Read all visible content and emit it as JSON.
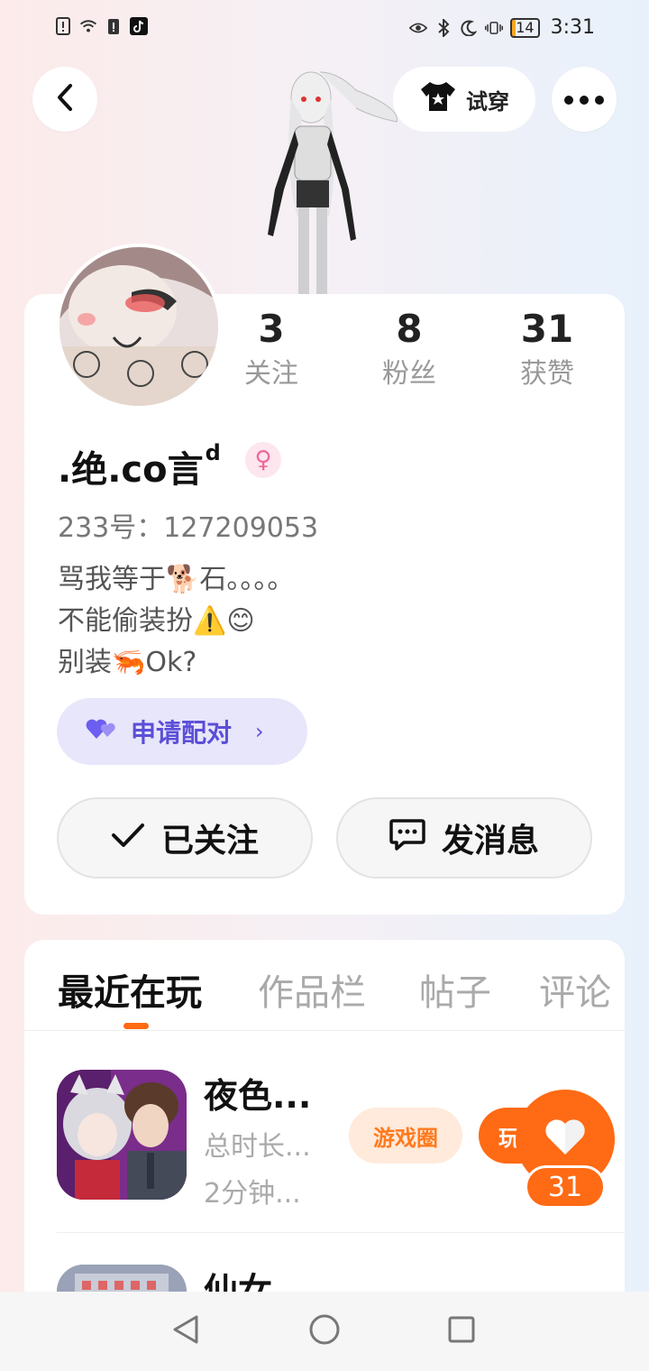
{
  "status_bar": {
    "time": "3:31",
    "battery": "14"
  },
  "header": {
    "try_on_label": "试穿"
  },
  "stats": [
    {
      "value": "3",
      "label": "关注"
    },
    {
      "value": "8",
      "label": "粉丝"
    },
    {
      "value": "31",
      "label": "获赞"
    }
  ],
  "profile": {
    "name": ".绝.co言",
    "name_sup": "d",
    "gender_symbol": "♀",
    "uid": "233号：127209053",
    "bio": [
      "骂我等于🐕石。。。。",
      "不能偷装扮⚠️😊",
      "别装🦐Ok?"
    ]
  },
  "pair": {
    "label": "申请配对",
    "arrow": "›"
  },
  "actions": {
    "follow_label": "已关注",
    "message_label": "发消息"
  },
  "tabs": [
    {
      "label": "最近在玩",
      "active": true
    },
    {
      "label": "作品栏",
      "active": false
    },
    {
      "label": "帖子",
      "active": false
    },
    {
      "label": "评论",
      "active": false
    }
  ],
  "games": [
    {
      "title": "夜色...",
      "meta1": "总时长...",
      "meta2": "2分钟...",
      "circle_label": "游戏圈",
      "play_label": "玩"
    },
    {
      "title": "仙女"
    }
  ],
  "like": {
    "count": "31"
  },
  "colors": {
    "accent": "#ff6a14",
    "pair_purple": "#5b4fd8",
    "gender_pink": "#f0689a"
  }
}
